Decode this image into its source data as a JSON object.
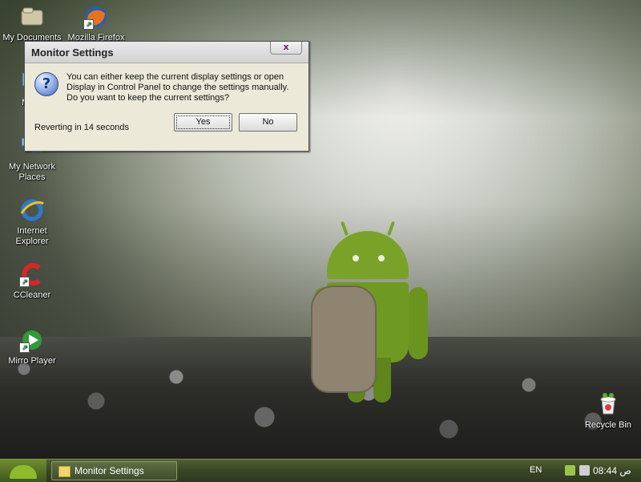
{
  "desktop": {
    "icons": [
      {
        "label": "My Documents"
      },
      {
        "label": "Mozilla Firefox"
      },
      {
        "label": "My C"
      },
      {
        "label": "My Network Places"
      },
      {
        "label": "Internet Explorer"
      },
      {
        "label": "CCleaner"
      },
      {
        "label": "Mirro Player"
      },
      {
        "label": "Recycle Bin"
      }
    ]
  },
  "dialog": {
    "title": "Monitor Settings",
    "close_label": "x",
    "message_lines": [
      "You can either keep the current display settings or open",
      "Display in Control Panel to change the settings manually.",
      "Do you want to keep the current settings?"
    ],
    "countdown": "Reverting in 14 seconds",
    "yes_label": "Yes",
    "no_label": "No"
  },
  "taskbar": {
    "task_button_label": "Monitor Settings",
    "language": "EN",
    "clock": "08:44 ص"
  },
  "colors": {
    "taskbar": "#3a4826",
    "dialog_bg": "#ece9d8",
    "android_green": "#7aa228"
  }
}
